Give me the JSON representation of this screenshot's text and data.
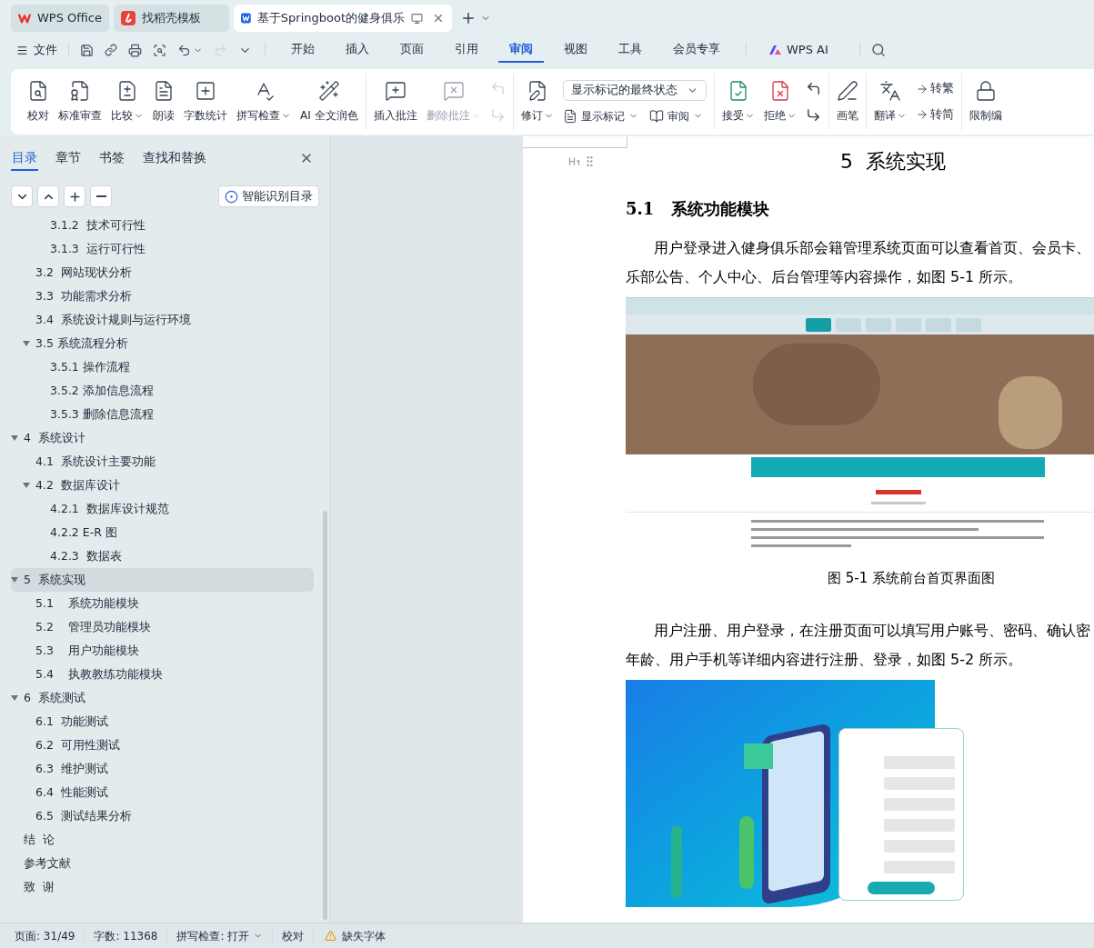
{
  "tabs": [
    {
      "label": "WPS Office",
      "kind": "home",
      "selected": false
    },
    {
      "label": "找稻壳模板",
      "kind": "template",
      "selected": false
    },
    {
      "label": "基于Springboot的健身俱乐",
      "kind": "doc",
      "selected": true
    }
  ],
  "menu": {
    "file": "文件",
    "tabs": [
      {
        "label": "开始",
        "selected": false
      },
      {
        "label": "插入",
        "selected": false
      },
      {
        "label": "页面",
        "selected": false
      },
      {
        "label": "引用",
        "selected": false
      },
      {
        "label": "审阅",
        "selected": true
      },
      {
        "label": "视图",
        "selected": false
      },
      {
        "label": "工具",
        "selected": false
      },
      {
        "label": "会员专享",
        "selected": false
      }
    ],
    "ai": "WPS AI"
  },
  "ribbon": [
    {
      "items": [
        {
          "kind": "large",
          "label": "校对",
          "dropdown": false,
          "disabled": false
        },
        {
          "kind": "large",
          "label": "标准审查",
          "dropdown": false,
          "disabled": false
        },
        {
          "kind": "large",
          "label": "比较",
          "dropdown": true,
          "disabled": false
        },
        {
          "kind": "large",
          "label": "朗读",
          "dropdown": false,
          "disabled": false
        },
        {
          "kind": "large",
          "label": "字数统计",
          "dropdown": false,
          "disabled": false
        },
        {
          "kind": "large",
          "label": "拼写检查",
          "dropdown": true,
          "disabled": false
        },
        {
          "kind": "large",
          "label": "AI 全文润色",
          "dropdown": false,
          "disabled": false
        }
      ]
    },
    {
      "items": [
        {
          "kind": "large",
          "label": "插入批注",
          "dropdown": false,
          "disabled": false
        },
        {
          "kind": "large",
          "label": "删除批注",
          "dropdown": true,
          "disabled": true
        },
        {
          "kind": "icon_pair",
          "disabled": true
        }
      ]
    },
    {
      "items": [
        {
          "kind": "large",
          "label": "修订",
          "dropdown": true,
          "disabled": false
        },
        {
          "kind": "select_group",
          "value": "显示标记的最终状态",
          "buttons": [
            {
              "label": "显示标记",
              "dropdown": true
            },
            {
              "label": "审阅",
              "dropdown": true
            }
          ]
        }
      ]
    },
    {
      "items": [
        {
          "kind": "large",
          "label": "接受",
          "dropdown": true,
          "disabled": false
        },
        {
          "kind": "large",
          "label": "拒绝",
          "dropdown": true,
          "disabled": false
        },
        {
          "kind": "icon_pair",
          "disabled": false
        }
      ]
    },
    {
      "items": [
        {
          "kind": "large",
          "label": "画笔",
          "dropdown": false,
          "disabled": false
        }
      ]
    },
    {
      "items": [
        {
          "kind": "large",
          "label": "翻译",
          "dropdown": true,
          "disabled": false
        },
        {
          "kind": "small_stack",
          "buttons": [
            {
              "label": "转繁"
            },
            {
              "label": "转简"
            }
          ]
        }
      ]
    },
    {
      "items": [
        {
          "kind": "large",
          "label": "限制编",
          "dropdown": false,
          "disabled": false
        }
      ]
    }
  ],
  "sidebar": {
    "tabs": [
      {
        "label": "目录",
        "selected": true
      },
      {
        "label": "章节",
        "selected": false
      },
      {
        "label": "书签",
        "selected": false
      },
      {
        "label": "查找和替换",
        "selected": false
      }
    ],
    "smart_button": "智能识别目录",
    "toc": [
      {
        "children": [
          {
            "children": [
              {
                "label": "3.1.2  技术可行性",
                "selected": false
              },
              {
                "label": "3.1.3  运行可行性",
                "selected": false
              }
            ]
          },
          {
            "label": "3.2  网站现状分析",
            "selected": false
          },
          {
            "label": "3.3  功能需求分析",
            "selected": false
          },
          {
            "label": "3.4  系统设计规则与运行环境",
            "selected": false
          },
          {
            "label": "3.5 系统流程分析",
            "selected": false,
            "expanded": true,
            "children": [
              {
                "label": "3.5.1 操作流程",
                "selected": false
              },
              {
                "label": "3.5.2 添加信息流程",
                "selected": false
              },
              {
                "label": "3.5.3 删除信息流程",
                "selected": false
              }
            ]
          }
        ]
      },
      {
        "label": "4  系统设计",
        "selected": false,
        "expanded": true,
        "children": [
          {
            "label": "4.1  系统设计主要功能",
            "selected": false
          },
          {
            "label": "4.2  数据库设计",
            "selected": false,
            "expanded": true,
            "children": [
              {
                "label": "4.2.1  数据库设计规范",
                "selected": false
              },
              {
                "label": "4.2.2 E-R 图",
                "selected": false
              },
              {
                "label": "4.2.3  数据表",
                "selected": false
              }
            ]
          }
        ]
      },
      {
        "label": "5  系统实现",
        "selected": true,
        "expanded": true,
        "children": [
          {
            "label": "5.1    系统功能模块",
            "selected": false
          },
          {
            "label": "5.2    管理员功能模块",
            "selected": false
          },
          {
            "label": "5.3    用户功能模块",
            "selected": false
          },
          {
            "label": "5.4    执教教练功能模块",
            "selected": false
          }
        ]
      },
      {
        "label": "6  系统测试",
        "selected": false,
        "expanded": true,
        "children": [
          {
            "label": "6.1  功能测试",
            "selected": false
          },
          {
            "label": "6.2  可用性测试",
            "selected": false
          },
          {
            "label": "6.3  维护测试",
            "selected": false
          },
          {
            "label": "6.4  性能测试",
            "selected": false
          },
          {
            "label": "6.5  测试结果分析",
            "selected": false
          }
        ]
      },
      {
        "label": "结  论",
        "selected": false
      },
      {
        "label": "参考文献",
        "selected": false
      },
      {
        "label": "致  谢",
        "selected": false
      }
    ]
  },
  "document": {
    "heading": "5  系统实现",
    "subheading": "5.1   系统功能模块",
    "blocks": [
      {
        "kind": "paragraph",
        "lines": [
          "用户登录进入健身俱乐部会籍管理系统页面可以查看首页、会员卡、",
          "乐部公告、个人中心、后台管理等内容操作，如图 5-1 所示。"
        ]
      },
      {
        "kind": "homepage_figure",
        "caption": "图 5-1 系统前台首页界面图"
      },
      {
        "kind": "paragraph",
        "lines": [
          "用户注册、用户登录，在注册页面可以填写用户账号、密码、确认密",
          "年龄、用户手机等详细内容进行注册、登录，如图 5-2 所示。"
        ]
      },
      {
        "kind": "register_figure"
      }
    ]
  },
  "status_bar": [
    {
      "kind": "plain",
      "text": "页面: 31/49"
    },
    {
      "kind": "plain",
      "text": "字数: 11368"
    },
    {
      "kind": "dropdown",
      "text": "拼写检查: 打开"
    },
    {
      "kind": "plain",
      "text": "校对"
    },
    {
      "kind": "warning",
      "text": "缺失字体"
    }
  ]
}
